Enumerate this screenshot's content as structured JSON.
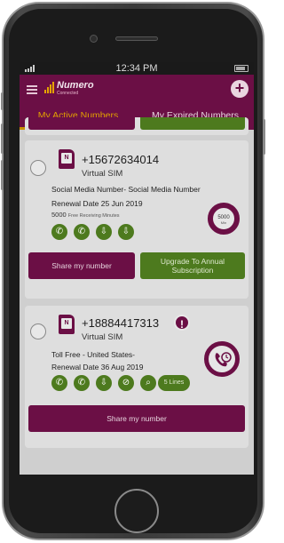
{
  "status_bar": {
    "time": "12:34 PM"
  },
  "app": {
    "logo_text": "Numero",
    "logo_sub": "Connected",
    "add_label": "+"
  },
  "tabs": [
    {
      "label": "My Active Numbers",
      "active": true
    },
    {
      "label": "My Expired Numbers",
      "active": false
    }
  ],
  "cards": [
    {
      "number": "+15672634014",
      "type": "Virtual SIM",
      "description": "Social Media Number- Social Media Number",
      "renewal": "Renewal Date 25 Jun 2019",
      "minutes_value": "5000",
      "minutes_label": "Free Receiving Minutes",
      "ring_value": "5000",
      "ring_unit": "Min",
      "share_label": "Share my number",
      "upgrade_label": "Upgrade To Annual Subscription"
    },
    {
      "number": "+18884417313",
      "type": "Virtual SIM",
      "description": "Toll Free - United States-",
      "renewal": "Renewal Date 36 Aug 2019",
      "lines_label": "5 Lines",
      "warning_glyph": "!",
      "share_label": "Share my number"
    }
  ],
  "colors": {
    "maroon": "#6b0f45",
    "green": "#4d7a1e",
    "gold": "#e0a000"
  },
  "icons": [
    "menu-icon",
    "add-icon",
    "sim-icon",
    "call-icon",
    "call-forward-icon",
    "download-icon",
    "no-sms-icon",
    "call-history-icon",
    "warning-icon"
  ]
}
